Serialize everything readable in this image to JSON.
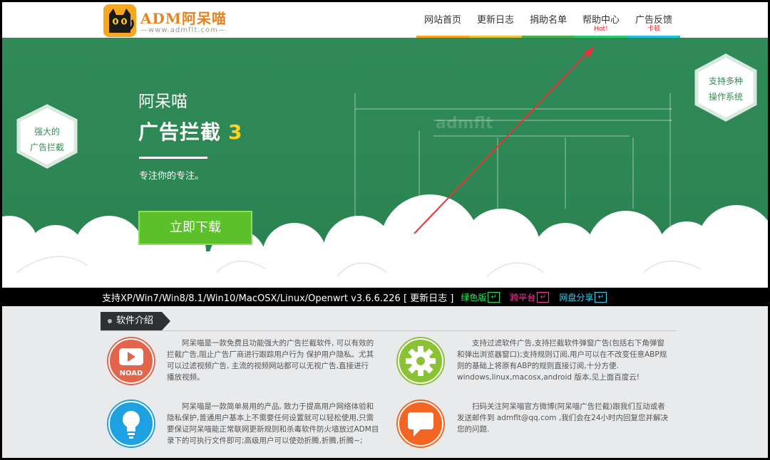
{
  "header": {
    "logo_title": "ADM阿呆喵",
    "logo_url": "—www.admflt.com—"
  },
  "nav": [
    {
      "label": "网站首页",
      "sub": "",
      "color": "#f5a623"
    },
    {
      "label": "更新日志",
      "sub": "",
      "color": "#e8c43a"
    },
    {
      "label": "捐助名单",
      "sub": "",
      "color": "#4caf50"
    },
    {
      "label": "帮助中心",
      "sub": "Hot!",
      "color": "#2ecc71"
    },
    {
      "label": "广告反馈",
      "sub": "卡顿",
      "color": "#22c5d8"
    }
  ],
  "hero": {
    "left_hex": [
      "强大的",
      "广告拦截"
    ],
    "right_hex": [
      "支持多种",
      "操作系统"
    ],
    "brand": "阿呆喵",
    "title": "广告拦截",
    "version": "3",
    "slogan": "专注你的专注。",
    "download_label": "立即下载",
    "watermark": "admflt"
  },
  "infobar": {
    "text": "支持XP/Win7/Win8/8.1/Win10/MacOSX/Linux/Openwrt v3.6.6.226 [ 更新日志 ]",
    "links": [
      {
        "label": "绿色版",
        "color": "#2ee05a"
      },
      {
        "label": "跨平台",
        "color": "#ff3aa0"
      },
      {
        "label": "网盘分享",
        "color": "#38d0f0"
      }
    ]
  },
  "intro": {
    "title": "软件介绍",
    "features": [
      {
        "icon": "no-ad-icon",
        "text": "阿呆喵是一款免费且功能强大的广告拦截软件, 可以有效的拦截广告,阻止广告厂商进行跟踪用户行为 保护用户隐私。尤其可以过滤视频广告, 主流的视频网站都可以无视广告,直接进行播放视频。"
      },
      {
        "icon": "gear-icon",
        "text": "支持过滤软件广告,支持拦截软件弹窗广告(包括右下角弹窗和弹出浏览器窗口);支持规则订阅,用户可以在不改变任意ABP规则的基础上将原有ABP的规则直接订阅,十分方便. windows,linux,macosx,android 版本,见上面百度云!"
      },
      {
        "icon": "lightbulb-icon",
        "text": "阿呆喵是一款简单易用的产品, 致力于提高用户网络体验和隐私保护,普通用户基本上不需要任何设置就可以轻松使用,只需要保证阿呆喵能正常联网更新规则和杀毒软件防火墙放过ADM目录下的可执行文件即可;高级用户可以使劲折腾,折腾,折腾~;"
      },
      {
        "icon": "chat-icon",
        "text": "扫码关注阿呆喵官方微博(阿呆喵广告拦截)跟我们互动或者发送邮件到 admflt@qq.com ,我们会在24小时内回复您并解决您的问题."
      }
    ]
  }
}
